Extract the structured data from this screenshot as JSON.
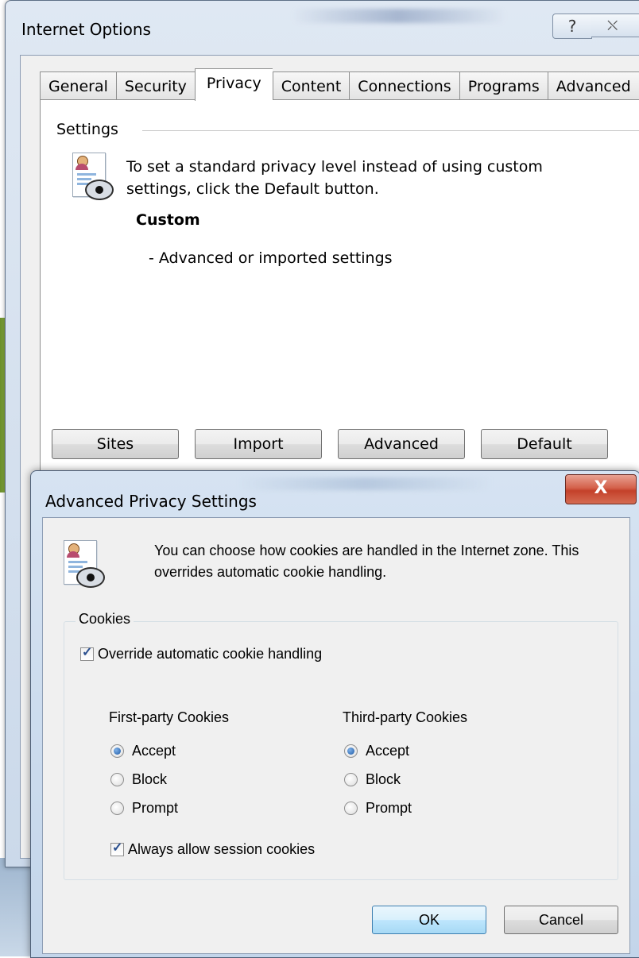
{
  "internet_options": {
    "title": "Internet Options",
    "help_glyph": "?",
    "close_glyph": "⛌",
    "tabs": [
      {
        "label": "General"
      },
      {
        "label": "Security"
      },
      {
        "label": "Privacy"
      },
      {
        "label": "Content"
      },
      {
        "label": "Connections"
      },
      {
        "label": "Programs"
      },
      {
        "label": "Advanced"
      }
    ],
    "settings": {
      "legend": "Settings",
      "icon": "privacy-document-eye-icon",
      "text": "To set a standard privacy level instead of using custom settings, click the Default button.",
      "level": "Custom",
      "level_desc": "- Advanced or imported settings"
    },
    "buttons": {
      "sites": "Sites",
      "import": "Import",
      "advanced": "Advanced",
      "default": "Default"
    }
  },
  "advanced_privacy": {
    "title": "Advanced Privacy Settings",
    "close_glyph": "X",
    "icon": "privacy-document-eye-icon",
    "text": "You can choose how cookies are handled in the Internet zone.  This overrides automatic cookie handling.",
    "cookies": {
      "legend": "Cookies",
      "override_label": "Override automatic cookie handling",
      "override_checked": true,
      "first_party": {
        "label": "First-party Cookies",
        "options": [
          "Accept",
          "Block",
          "Prompt"
        ],
        "selected": "Accept"
      },
      "third_party": {
        "label": "Third-party Cookies",
        "options": [
          "Accept",
          "Block",
          "Prompt"
        ],
        "selected": "Accept"
      },
      "session_label": "Always allow session cookies",
      "session_checked": true
    },
    "buttons": {
      "ok": "OK",
      "cancel": "Cancel"
    }
  },
  "colors": {
    "aero_title": "#cbd9ea",
    "close_red": "#c4412a",
    "default_button": "#bee6fd"
  }
}
